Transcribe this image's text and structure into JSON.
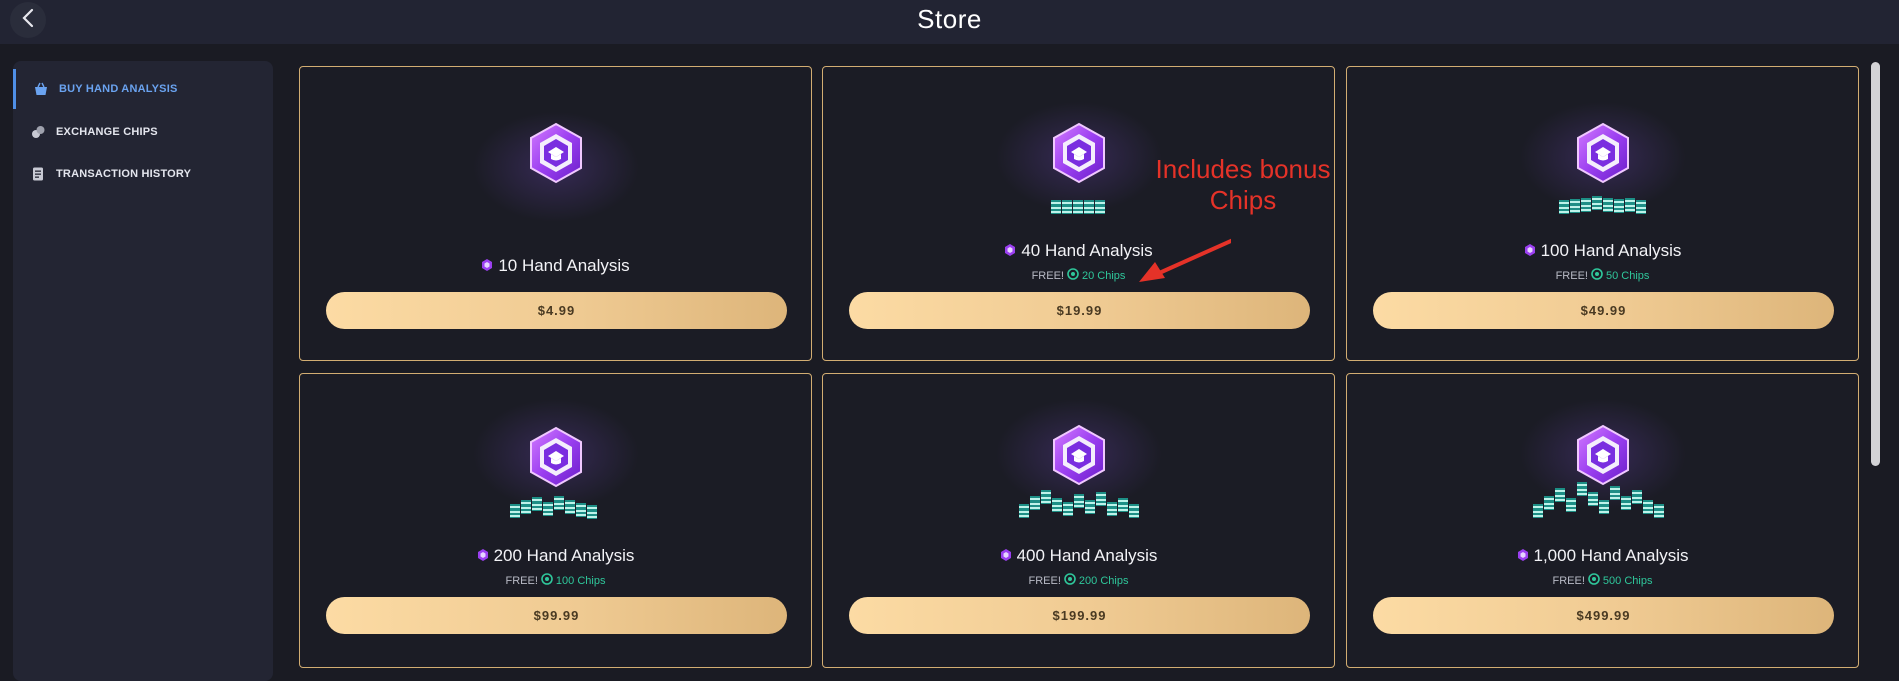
{
  "header": {
    "title": "Store"
  },
  "sidebar": {
    "items": [
      {
        "label": "BUY HAND ANALYSIS",
        "icon": "basket-icon",
        "active": true
      },
      {
        "label": "EXCHANGE CHIPS",
        "icon": "chips-icon",
        "active": false
      },
      {
        "label": "TRANSACTION HISTORY",
        "icon": "receipt-icon",
        "active": false
      }
    ]
  },
  "products": [
    {
      "title": "10 Hand Analysis",
      "free_label": "",
      "chips": "",
      "price": "$4.99"
    },
    {
      "title": "40 Hand Analysis",
      "free_label": "FREE!",
      "chips": "20 Chips",
      "price": "$19.99"
    },
    {
      "title": "100 Hand Analysis",
      "free_label": "FREE!",
      "chips": "50 Chips",
      "price": "$49.99"
    },
    {
      "title": "200 Hand Analysis",
      "free_label": "FREE!",
      "chips": "100 Chips",
      "price": "$99.99"
    },
    {
      "title": "400 Hand Analysis",
      "free_label": "FREE!",
      "chips": "200 Chips",
      "price": "$199.99"
    },
    {
      "title": "1,000 Hand Analysis",
      "free_label": "FREE!",
      "chips": "500 Chips",
      "price": "$499.99"
    }
  ],
  "annotation": {
    "line1": "Includes bonus",
    "line2": "Chips"
  },
  "colors": {
    "accent": "#6aa3f0",
    "card_border": "#d2ad72",
    "chips_text": "#2fc79b",
    "annotation_red": "#e53228",
    "hex_purple": "#9b3ff0"
  }
}
